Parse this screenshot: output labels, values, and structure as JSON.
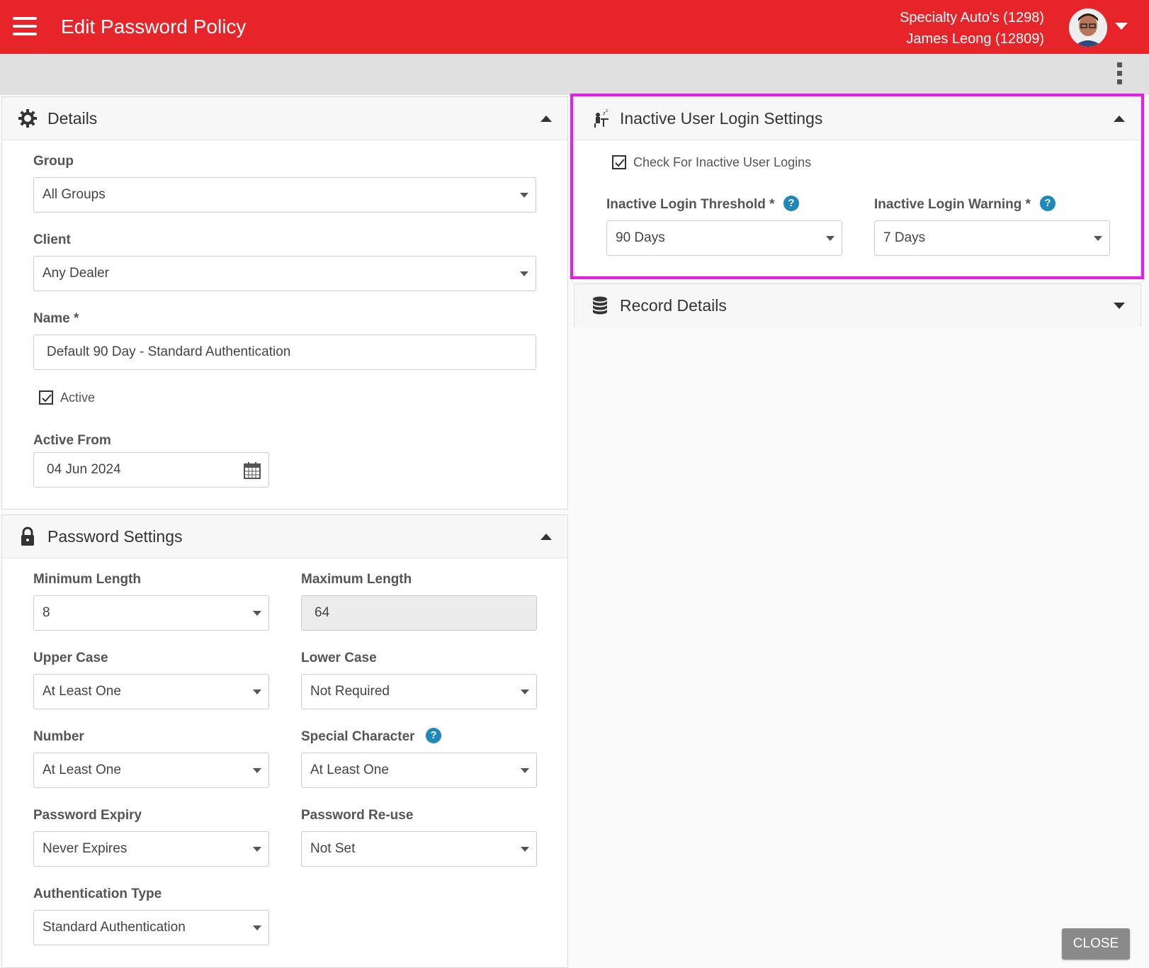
{
  "header": {
    "title": "Edit Password Policy",
    "dealer": "Specialty Auto's (1298)",
    "user": "James Leong (12809)"
  },
  "details": {
    "title": "Details",
    "group_label": "Group",
    "group_value": "All Groups",
    "client_label": "Client",
    "client_value": "Any Dealer",
    "name_label": "Name *",
    "name_value": "Default 90 Day - Standard Authentication",
    "active_label": "Active",
    "active_checked": true,
    "active_from_label": "Active From",
    "active_from_value": "04 Jun 2024"
  },
  "password_settings": {
    "title": "Password Settings",
    "min_length_label": "Minimum Length",
    "min_length_value": "8",
    "max_length_label": "Maximum Length",
    "max_length_value": "64",
    "upper_case_label": "Upper Case",
    "upper_case_value": "At Least One",
    "lower_case_label": "Lower Case",
    "lower_case_value": "Not Required",
    "number_label": "Number",
    "number_value": "At Least One",
    "special_label": "Special Character",
    "special_value": "At Least One",
    "expiry_label": "Password Expiry",
    "expiry_value": "Never Expires",
    "reuse_label": "Password Re-use",
    "reuse_value": "Not Set",
    "auth_type_label": "Authentication Type",
    "auth_type_value": "Standard Authentication"
  },
  "inactive_settings": {
    "title": "Inactive User Login Settings",
    "check_label": "Check For Inactive User Logins",
    "check_checked": true,
    "threshold_label": "Inactive Login Threshold *",
    "threshold_value": "90 Days",
    "warning_label": "Inactive Login Warning *",
    "warning_value": "7 Days"
  },
  "record_details": {
    "title": "Record Details"
  },
  "help_glyph": "?",
  "close_label": "CLOSE",
  "colors": {
    "header_bg": "#e62429",
    "highlight": "#e21ee8",
    "help": "#1e88b8"
  }
}
